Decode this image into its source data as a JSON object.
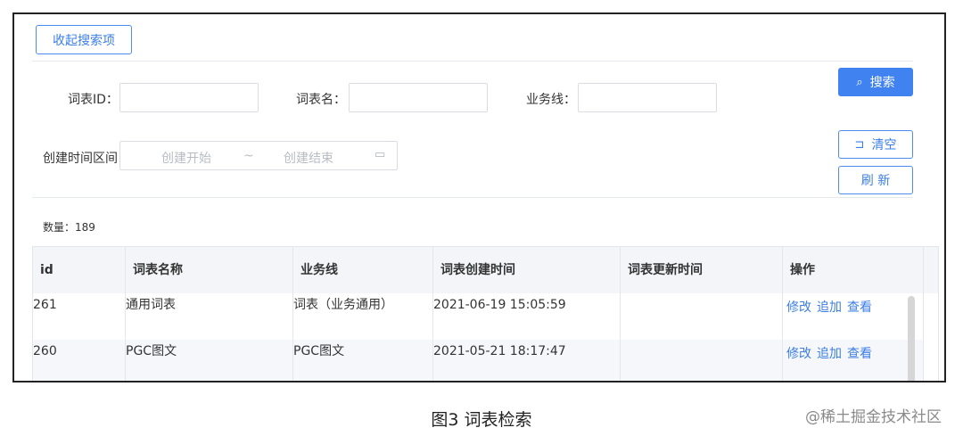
{
  "toolbar": {
    "collapse_label": "收起搜索项"
  },
  "search_form": {
    "field_id_label": "词表ID：",
    "field_name_label": "词表名：",
    "field_business_label": "业务线：",
    "field_time_label": "创建时间区间",
    "range_start_placeholder": "创建开始",
    "range_separator": "~",
    "range_end_placeholder": "创建结束",
    "search_label": "搜索",
    "clear_label": "清空",
    "refresh_label": "刷 新"
  },
  "count_text": "数量：189",
  "table": {
    "columns": [
      "id",
      "词表名称",
      "业务线",
      "词表创建时间",
      "词表更新时间",
      "操作"
    ],
    "rows": [
      {
        "id": "261",
        "name": "通用词表",
        "business": "词表（业务通用）",
        "created": "2021-06-19 15:05:59",
        "updated": ""
      },
      {
        "id": "260",
        "name": "PGC图文",
        "business": "PGC图文",
        "created": "2021-05-21 18:17:47",
        "updated": ""
      }
    ],
    "actions": [
      "修改",
      "追加",
      "查看"
    ]
  },
  "caption": "图3 词表检索",
  "watermark": "@稀土掘金技术社区"
}
